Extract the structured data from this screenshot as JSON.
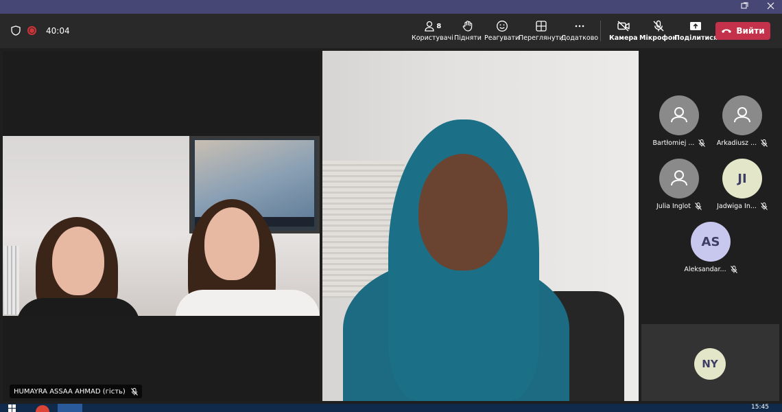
{
  "titlebar": {
    "popout_icon": "popout-icon",
    "close_icon": "close-icon"
  },
  "toolbar": {
    "timer": "40:04",
    "participants_count": "8",
    "buttons": {
      "people": "Користувачі",
      "raise": "Підняти",
      "react": "Реагувати",
      "view": "Переглянути",
      "more": "Додатково",
      "camera": "Камера",
      "mic": "Мікрофон",
      "share": "Поділитися"
    },
    "leave_label": "Вийти"
  },
  "stage": {
    "tile1_name": "HUMAYRA ASSAA AHMAD (гість)"
  },
  "roster": [
    {
      "name": "Bartłomiej ...",
      "initials": ""
    },
    {
      "name": "Arkadiusz ...",
      "initials": ""
    },
    {
      "name": "Julia Inglot",
      "initials": ""
    },
    {
      "name": "Jadwiga In...",
      "initials": "JI"
    },
    {
      "name": "Aleksandar...",
      "initials": "AS"
    }
  ],
  "self": {
    "initials": "NY"
  },
  "taskbar": {
    "clock": "15:45"
  },
  "colors": {
    "accent": "#464775",
    "leave": "#c4314b",
    "toolbar": "#292929"
  }
}
